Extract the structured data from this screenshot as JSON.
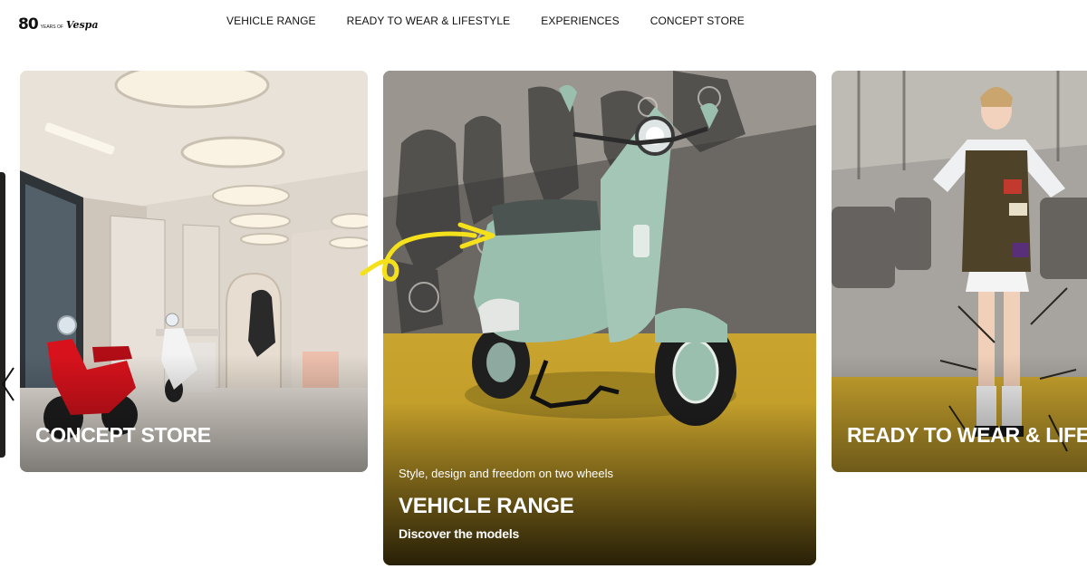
{
  "header": {
    "logo": {
      "number": "80",
      "small_text": "YEARS OF",
      "brand": "Vespa"
    },
    "nav": [
      {
        "label": "VEHICLE RANGE"
      },
      {
        "label": "READY TO WEAR & LIFESTYLE"
      },
      {
        "label": "EXPERIENCES"
      },
      {
        "label": "CONCEPT STORE"
      }
    ]
  },
  "carousel": {
    "prev_icon": "chevron-left-icon",
    "cards": [
      {
        "title": "CONCEPT STORE"
      },
      {
        "subtitle": "Style, design and freedom on two wheels",
        "title": "VEHICLE RANGE",
        "cta": "Discover the models"
      },
      {
        "title": "READY TO WEAR & LIFESTYLE"
      }
    ]
  },
  "colors": {
    "accent_yellow": "#f5e11b",
    "floor_mustard": "#c9a42e",
    "scooter_mint": "#9bbfae",
    "scooter_red": "#d8121c"
  }
}
